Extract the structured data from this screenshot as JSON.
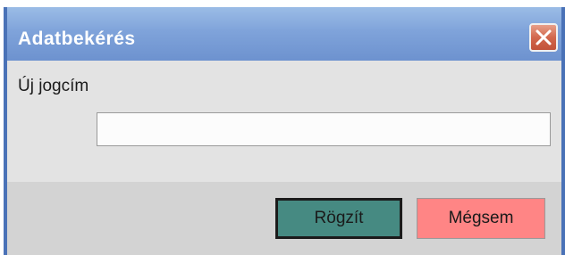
{
  "window": {
    "title": "Adatbekérés",
    "close_icon": "close-icon"
  },
  "form": {
    "label": "Új jogcím",
    "input_value": "",
    "input_placeholder": ""
  },
  "buttons": {
    "save_label": "Rögzít",
    "cancel_label": "Mégsem"
  },
  "colors": {
    "titlebar": "#7fa3da",
    "save_button": "#468a82",
    "cancel_button": "#ff8585",
    "close_button": "#d2674d"
  }
}
